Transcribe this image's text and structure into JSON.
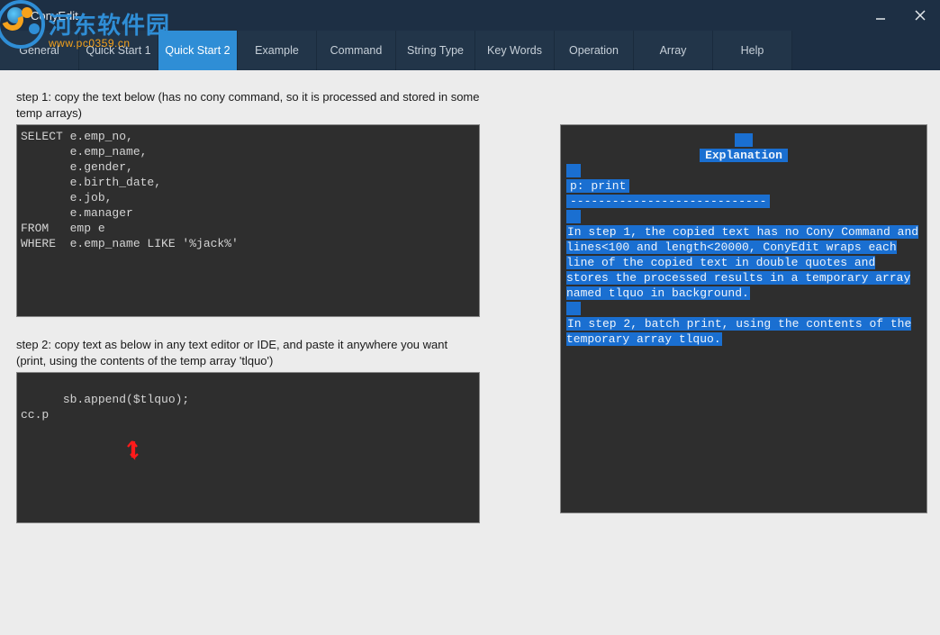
{
  "app": {
    "title": "ConyEdit"
  },
  "watermark": {
    "cn": "河东软件园",
    "url": "www.pc0359.cn"
  },
  "tabs": [
    {
      "label": "General"
    },
    {
      "label": "Quick Start 1"
    },
    {
      "label": "Quick Start 2",
      "active": true
    },
    {
      "label": "Example"
    },
    {
      "label": "Command"
    },
    {
      "label": "String Type"
    },
    {
      "label": "Key Words"
    },
    {
      "label": "Operation"
    },
    {
      "label": "Array"
    },
    {
      "label": "Help"
    }
  ],
  "steps": {
    "step1_text": "step 1: copy the text below (has no cony command, so it is processed and stored in some temp arrays)",
    "step1_code": "SELECT e.emp_no,\n       e.emp_name,\n       e.gender,\n       e.birth_date,\n       e.job,\n       e.manager\nFROM   emp e\nWHERE  e.emp_name LIKE '%jack%'",
    "step2_text": "step 2: copy text as below in any text editor or IDE, and paste it anywhere you want (print, using the contents of the temp array 'tlquo')",
    "step2_code": "sb.append($tlquo);\ncc.p"
  },
  "explanation": {
    "title": "Explanation",
    "line_p": "p:  print",
    "rule": "----------------------------",
    "para1": "  In step 1, the copied text has no Cony Command and lines<100 and length<20000, ConyEdit wraps each line of the copied text in double quotes and stores the processed results in a temporary array named tlquo in background.",
    "para2": "  In step 2, batch print, using the contents of the temporary array tlquo."
  }
}
